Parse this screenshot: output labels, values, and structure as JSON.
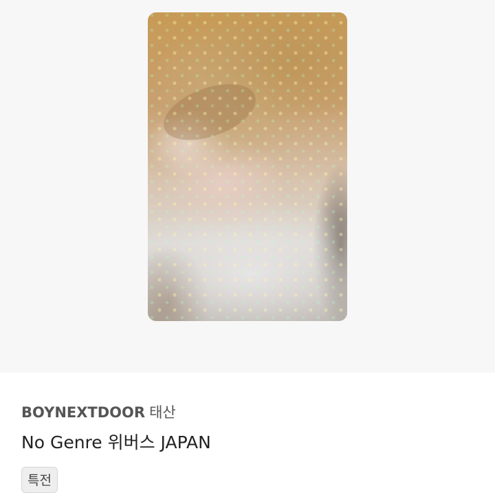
{
  "listing": {
    "artist": "BOYNEXTDOOR",
    "member": "태산",
    "title": "No Genre 위버스 JAPAN",
    "tag": "특전"
  }
}
